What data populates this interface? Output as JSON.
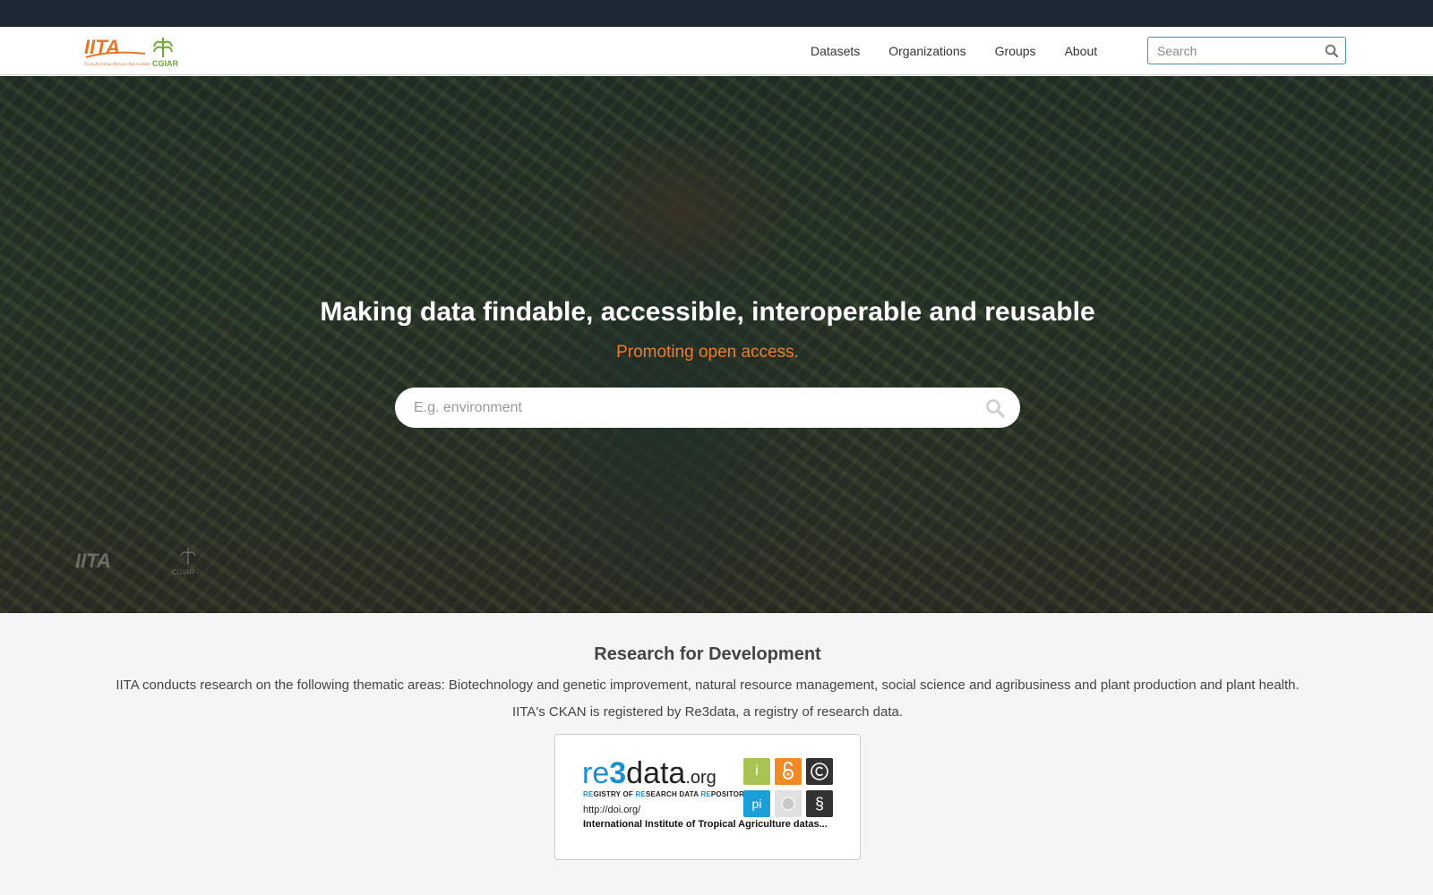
{
  "colors": {
    "topbar": "#1c2833",
    "accent_orange": "#f07d2c",
    "iita_orange": "#e8762b",
    "cgiar_green": "#6ea83a",
    "re3data_blue": "#1a8fd0"
  },
  "header": {
    "logo": {
      "text": "IITA",
      "tagline": "Transforming African Agriculture",
      "partner": "CGIAR"
    },
    "nav": [
      {
        "label": "Datasets"
      },
      {
        "label": "Organizations"
      },
      {
        "label": "Groups"
      },
      {
        "label": "About"
      }
    ],
    "search": {
      "placeholder": "Search",
      "icon": "search-icon"
    }
  },
  "hero": {
    "title": "Making data findable, accessible, interoperable and reusable",
    "tagline": "Promoting open access.",
    "search": {
      "placeholder": "E.g. environment",
      "icon": "search-icon"
    }
  },
  "section": {
    "title": "Research for Development",
    "description": "IITA conducts research on the following thematic areas: Biotechnology and genetic improvement, natural resource management, social science and agribusiness and plant production and plant health.",
    "registry_note": "IITA's CKAN is registered by Re3data, a registry of research data."
  },
  "badge": {
    "brand_re": "re",
    "brand_3": "3",
    "brand_data": "data",
    "brand_org": ".org",
    "tagline": "REGISTRY OF RESEARCH DATA REPOSITORIES",
    "doi": "http://doi.org/",
    "repository_name": "International Institute of Tropical Agriculture datas...",
    "icons": [
      {
        "name": "info-icon",
        "label": "i",
        "color": "#a9c454"
      },
      {
        "name": "open-access-icon",
        "label": "",
        "color": "#f08a24"
      },
      {
        "name": "copyright-icon",
        "label": "",
        "color": "#333333"
      },
      {
        "name": "pid-icon",
        "label": "pi",
        "color": "#1a9fd8"
      },
      {
        "name": "certificate-icon",
        "label": "",
        "color": "#e0e0e0"
      },
      {
        "name": "policy-icon",
        "label": "§",
        "color": "#333333"
      }
    ]
  }
}
